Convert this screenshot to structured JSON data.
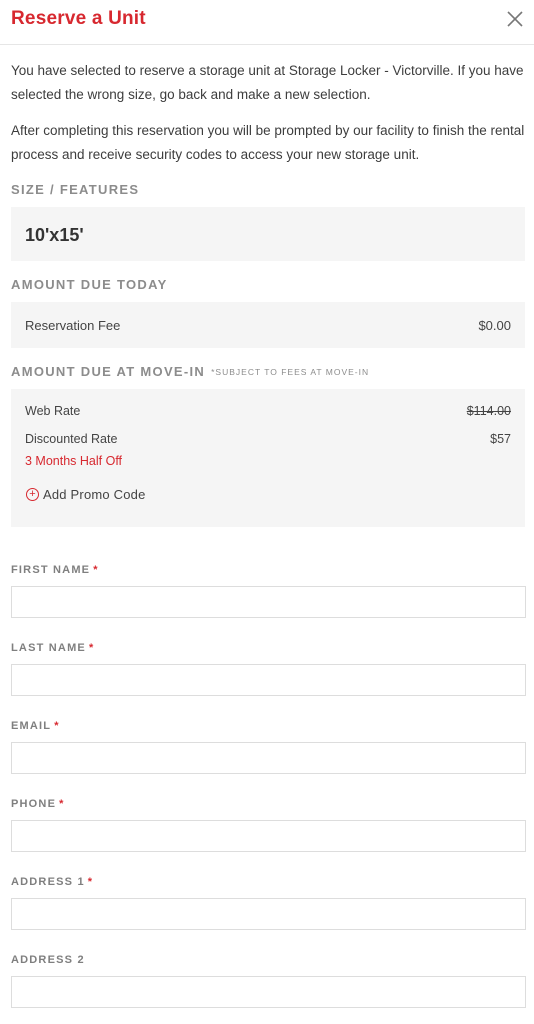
{
  "header": {
    "title": "Reserve a Unit",
    "close_icon": "close-icon"
  },
  "intro": {
    "paragraph1": "You have selected to reserve a storage unit at Storage Locker - Victorville. If you have selected the wrong size, go back and make a new selection.",
    "paragraph2": "After completing this reservation you will be prompted by our facility to finish the rental process and receive security codes to access your new storage unit."
  },
  "size": {
    "label": "SIZE / FEATURES",
    "value": "10'x15'"
  },
  "amount_due_today": {
    "label": "AMOUNT DUE TODAY",
    "fee_label": "Reservation Fee",
    "fee_value": "$0.00"
  },
  "amount_due_move_in": {
    "label": "AMOUNT DUE AT MOVE-IN",
    "note": "*SUBJECT TO FEES AT MOVE-IN",
    "web_rate_label": "Web Rate",
    "web_rate_value": "$114.00",
    "discount_label": "Discounted Rate",
    "discount_value": "$57",
    "promotion": "3 Months Half Off",
    "add_promo_label": "Add Promo Code"
  },
  "form": {
    "required_marker": "*",
    "fields": [
      {
        "label": "FIRST NAME",
        "required": true,
        "value": ""
      },
      {
        "label": "LAST NAME",
        "required": true,
        "value": ""
      },
      {
        "label": "EMAIL",
        "required": true,
        "value": ""
      },
      {
        "label": "PHONE",
        "required": true,
        "value": ""
      },
      {
        "label": "ADDRESS 1",
        "required": true,
        "value": ""
      },
      {
        "label": "ADDRESS 2",
        "required": false,
        "value": ""
      }
    ]
  },
  "colors": {
    "accent": "#d7282f",
    "label_gray": "#8c8c8c",
    "panel_bg": "#f5f5f5"
  }
}
